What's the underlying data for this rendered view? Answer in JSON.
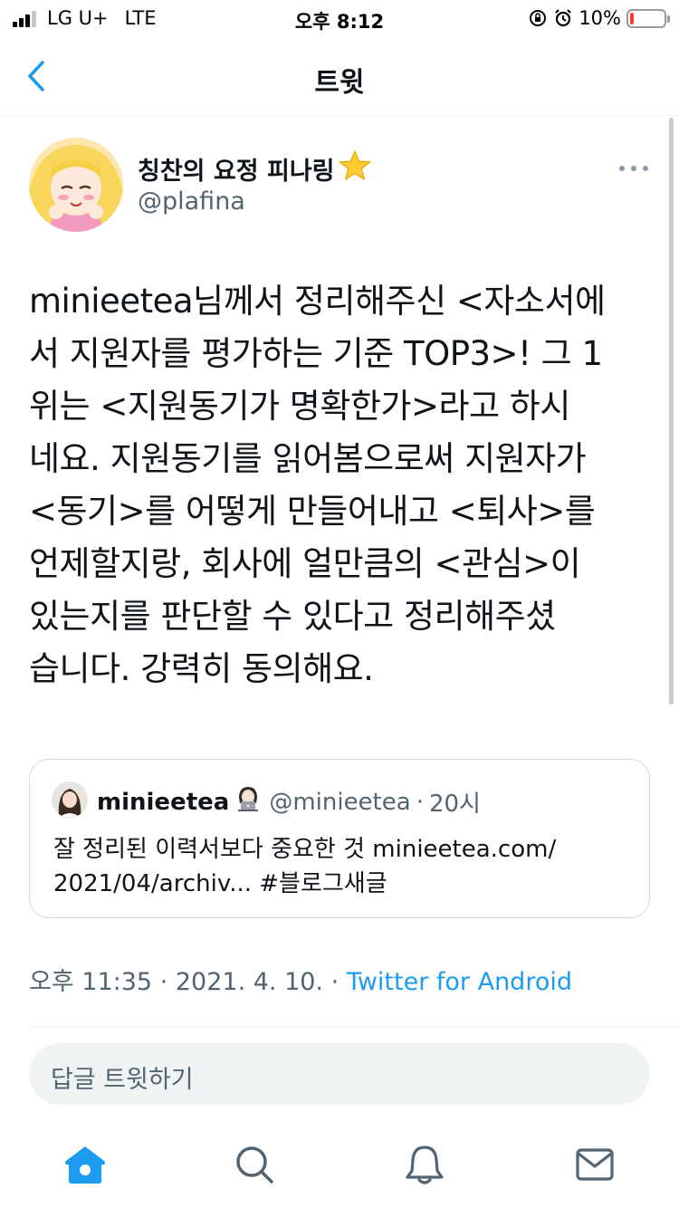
{
  "status_bar": {
    "carrier": "LG U+",
    "network": "LTE",
    "time": "오후 8:12",
    "battery": "10%",
    "battery_level": 0.1
  },
  "nav": {
    "title": "트윗",
    "back_icon": "chevron-left-icon"
  },
  "tweet": {
    "author_name": "칭찬의 요정 피나링",
    "author_handle": "@plafina",
    "text": "minieetea님께서 정리해주신 <자소서에\n서 지원자를 평가하는 기준 TOP3>! 그 1\n위는 <지원동기가 명확한가>라고 하시\n네요. 지원동기를 읽어봄으로써 지원자가\n<동기>를 어떻게 만들어내고 <퇴사>를\n언제할지랑, 회사에 얼만큼의 <관심>이\n있는지를 판단할 수 있다고 정리해주셨\n습니다. 강력히 동의해요.",
    "time": "오후 11:35",
    "date": "2021. 4. 10.",
    "separator": "·",
    "source": "Twitter for Android"
  },
  "quote": {
    "name": "minieetea",
    "handle": "@minieetea",
    "separator": "·",
    "time": "20시",
    "text": "잘 정리된 이력서보다 중요한  것 minieetea.com/\n2021/04/archiv... #블로그새글"
  },
  "reply": {
    "placeholder": "답글 트윗하기"
  },
  "tab_bar": {
    "items": [
      {
        "icon": "home-icon",
        "active": true
      },
      {
        "icon": "search-icon"
      },
      {
        "icon": "notifications-icon"
      },
      {
        "icon": "messages-icon"
      }
    ]
  },
  "colors": {
    "accent": "#1d9bf0",
    "text": "#0f1419",
    "secondary": "#536471",
    "border": "#cfd9de",
    "battery_low": "#ff3b30"
  }
}
